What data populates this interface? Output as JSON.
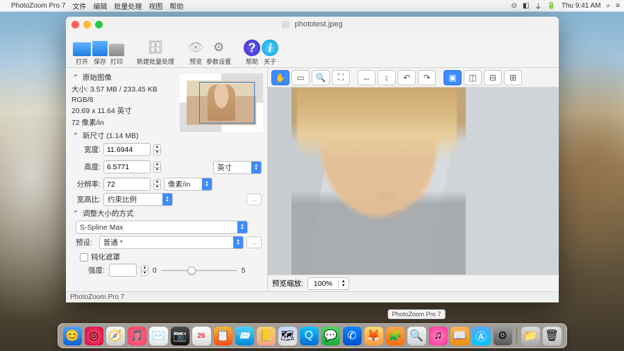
{
  "menubar": {
    "app": "PhotoZoom Pro 7",
    "items": [
      "文件",
      "编辑",
      "批量处理",
      "视图",
      "帮助"
    ],
    "clock": "Thu 9:41 AM"
  },
  "titlebar": {
    "filename": "phototest.jpeg"
  },
  "toolbar": {
    "open": "打开",
    "save": "保存",
    "print": "打印",
    "batch": "新建批量处理",
    "preview": "预览",
    "settings": "参数设置",
    "help": "帮助",
    "about": "关于"
  },
  "left": {
    "orig_head": "原始图像",
    "size": "大小: 3.57 MB / 233.45 KB",
    "mode": "RGB/8",
    "dim": "20.69 x 11.64 英寸",
    "ppi": "72 像素/in",
    "new_head": "新尺寸 (1.14 MB)",
    "w_label": "宽度:",
    "w_val": "11.6944",
    "h_label": "高度:",
    "h_val": "6.5771",
    "unit_sel": "英寸",
    "res_label": "分辨率:",
    "res_val": "72",
    "res_unit": "像素/in",
    "ar_label": "宽高比:",
    "ar_val": "约束比例",
    "resize_head": "调整大小的方式",
    "method": "S-Spline Max",
    "preset_label": "预设:",
    "preset_val": "普通 *",
    "sharpen": "钝化遮罩",
    "strength": "强度:",
    "strength_val": "",
    "s_lo": "0",
    "s_hi": "5",
    "tri_dots": "..."
  },
  "preview": {
    "zoom_label": "预览缩放:",
    "zoom_val": "100%"
  },
  "footer": {
    "app": "PhotoZoom Pro 7"
  },
  "dock": {
    "tooltip": "PhotoZoom Pro 7"
  }
}
